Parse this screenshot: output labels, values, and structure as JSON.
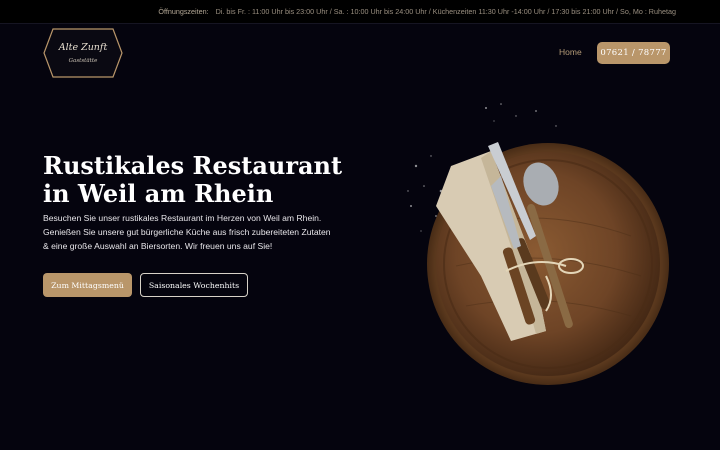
{
  "topbar": {
    "label": "Öffnungszeiten:",
    "hours": "Di. bis Fr. : 11:00 Uhr bis 23:00 Uhr  / Sa. : 10:00 Uhr bis 24:00 Uhr / Küchenzeiten 11:30 Uhr -14:00 Uhr / 17:30 bis 21:00 Uhr / So, Mo : Ruhetag"
  },
  "logo": {
    "name": "Alte Zunft",
    "subtitle": "Gaststätte"
  },
  "nav": {
    "home": "Home",
    "phone": "07621 / 78777"
  },
  "hero": {
    "title_line1": "Rustikales Restaurant",
    "title_line2": "in Weil am Rhein",
    "text": "Besuchen Sie unser rustikales Restaurant im Herzen von Weil am Rhein. Genießen Sie unsere gut bürgerliche Küche aus frisch zubereiteten Zutaten & eine große Auswahl an Biersorten. Wir freuen uns auf Sie!",
    "primary_button": "Zum Mittagsmenü",
    "secondary_button": "Saisonales Wochenhits"
  },
  "colors": {
    "background": "#05040e",
    "accent": "#b9966a",
    "topbar": "#000000"
  },
  "icons": {
    "hero_image": "wooden-board-with-cutlery-icon"
  }
}
